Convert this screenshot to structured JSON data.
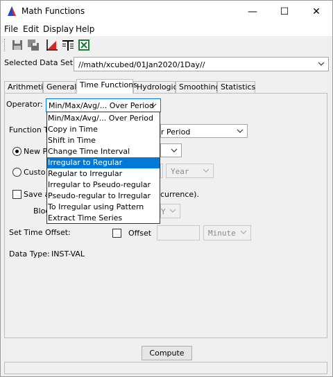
{
  "window": {
    "title": "Math Functions",
    "controls": {
      "minimize": "—",
      "maximize": "☐",
      "close": "✕"
    }
  },
  "menu": [
    "File",
    "Edit",
    "Display",
    "Help"
  ],
  "toolbar": {
    "icons": [
      "save-icon",
      "save-all-icon",
      "plot-icon",
      "table-icon",
      "excel-icon"
    ]
  },
  "dataset": {
    "label": "Selected Data Set:",
    "value": "//math/xcubed/01Jan2020/1Day//"
  },
  "tabs": [
    "Arithmetic",
    "General",
    "Time Functions",
    "Hydrologic",
    "Smoothing",
    "Statistics"
  ],
  "active_tab": "Time Functions",
  "operator": {
    "label": "Operator:",
    "value": "Min/Max/Avg/... Over Period"
  },
  "dropdown": {
    "options": [
      "Min/Max/Avg/... Over Period",
      "Copy in Time",
      "Shift in Time",
      "Change Time Interval",
      "Irregular to Regular",
      "Regular to Irregular",
      "Irregular to Pseudo-regular",
      "Pseudo-regular to Irregular",
      "To Irregular using Pattern",
      "Extract Time Series"
    ],
    "selected": "Irregular to Regular"
  },
  "form": {
    "function_type_label": "Function Ty",
    "function_type_value": "r Period",
    "new_period_label": "New Pe",
    "custom_label": "Custo",
    "year_value": "Year",
    "save_label": "Save a",
    "save_suffix": "currence).",
    "block_label": "Bloc",
    "block_value": "Y",
    "time_offset_label": "Set Time Offset:",
    "offset_label": "Offset",
    "offset_unit": "Minute",
    "data_type_label": "Data Type:",
    "data_type_value": "INST-VAL"
  },
  "compute_label": "Compute",
  "colors": {
    "selection": "#0078d7",
    "window_bg": "#f0f0f0"
  }
}
